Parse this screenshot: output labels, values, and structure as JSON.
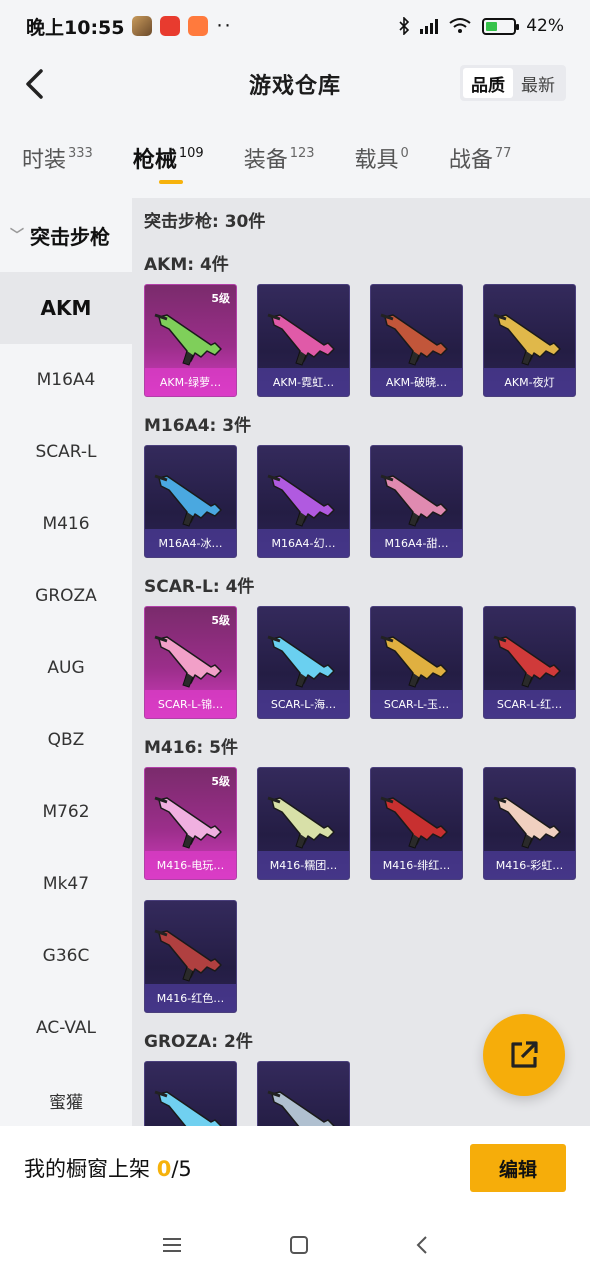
{
  "status": {
    "time": "晚上10:55",
    "more": "··",
    "battery": "42%",
    "battery_level": 0.42
  },
  "header": {
    "title": "游戏仓库",
    "sort_options": [
      "品质",
      "最新"
    ]
  },
  "tabs": [
    {
      "label": "时装",
      "count": "333"
    },
    {
      "label": "枪械",
      "count": "109"
    },
    {
      "label": "装备",
      "count": "123"
    },
    {
      "label": "载具",
      "count": "0"
    },
    {
      "label": "战备",
      "count": "77"
    }
  ],
  "sidebar": {
    "category": "突击步枪",
    "items": [
      "AKM",
      "M16A4",
      "SCAR-L",
      "M416",
      "GROZA",
      "AUG",
      "QBZ",
      "M762",
      "Mk47",
      "G36C",
      "AC-VAL",
      "蜜獾"
    ]
  },
  "main": {
    "category_header": "突击步枪: 30件",
    "groups": [
      {
        "title": "AKM: 4件",
        "cards": [
          {
            "name": "AKM-绿萝…",
            "level": "5级",
            "tier": "gold",
            "accent": "#7fcf5a"
          },
          {
            "name": "AKM-霓虹…",
            "level": "",
            "tier": "purple",
            "accent": "#e05aa8"
          },
          {
            "name": "AKM-破晓…",
            "level": "",
            "tier": "purple",
            "accent": "#c2563a"
          },
          {
            "name": "AKM-夜灯",
            "level": "",
            "tier": "purple",
            "accent": "#e0b84a"
          }
        ]
      },
      {
        "title": "M16A4: 3件",
        "cards": [
          {
            "name": "M16A4-冰…",
            "level": "",
            "tier": "purple",
            "accent": "#4aa8e0"
          },
          {
            "name": "M16A4-幻…",
            "level": "",
            "tier": "purple",
            "accent": "#b05ae0"
          },
          {
            "name": "M16A4-甜…",
            "level": "",
            "tier": "purple",
            "accent": "#e08ab0"
          }
        ]
      },
      {
        "title": "SCAR-L: 4件",
        "cards": [
          {
            "name": "SCAR-L-锦…",
            "level": "5级",
            "tier": "gold",
            "accent": "#f2a0c8"
          },
          {
            "name": "SCAR-L-海…",
            "level": "",
            "tier": "purple",
            "accent": "#6ad0f0"
          },
          {
            "name": "SCAR-L-玉…",
            "level": "",
            "tier": "purple",
            "accent": "#e0b040"
          },
          {
            "name": "SCAR-L-红…",
            "level": "",
            "tier": "purple",
            "accent": "#d03a3a"
          }
        ]
      },
      {
        "title": "M416: 5件",
        "cards": [
          {
            "name": "M416-电玩…",
            "level": "5级",
            "tier": "gold",
            "accent": "#f0b0e0"
          },
          {
            "name": "M416-糯团…",
            "level": "",
            "tier": "purple",
            "accent": "#d8e0a8"
          },
          {
            "name": "M416-绯红…",
            "level": "",
            "tier": "purple",
            "accent": "#c83030"
          },
          {
            "name": "M416-彩虹…",
            "level": "",
            "tier": "purple",
            "accent": "#f0d0c0"
          },
          {
            "name": "M416-红色…",
            "level": "",
            "tier": "purple",
            "accent": "#b04040"
          }
        ]
      },
      {
        "title": "GROZA: 2件",
        "cards": [
          {
            "name": "",
            "level": "",
            "tier": "purple",
            "accent": "#70d0f0"
          },
          {
            "name": "",
            "level": "",
            "tier": "purple",
            "accent": "#b0c0d0"
          }
        ]
      }
    ]
  },
  "bottom": {
    "shelf_label": "我的橱窗上架",
    "shelf_current": "0",
    "shelf_total": "/5",
    "edit_label": "编辑"
  },
  "colors": {
    "accent": "#f6ad0a"
  }
}
